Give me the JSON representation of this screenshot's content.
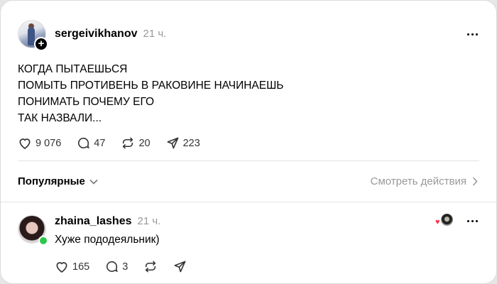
{
  "post": {
    "username": "sergeivikhanov",
    "time": "21 ч.",
    "text_lines": [
      "КОГДА ПЫТАЕШЬСЯ",
      "ПОМЫТЬ ПРОТИВЕНЬ В РАКОВИНЕ НАЧИНАЕШЬ",
      "ПОНИМАТЬ ПОЧЕМУ ЕГО",
      "ТАК НАЗВАЛИ..."
    ],
    "likes": "9 076",
    "replies": "47",
    "reposts": "20",
    "shares": "223",
    "follow_glyph": "+"
  },
  "sort": {
    "label": "Популярные",
    "view_activity": "Смотреть действия"
  },
  "reply": {
    "username": "zhaina_lashes",
    "time": "21 ч.",
    "text": "Хуже пододеяльник)",
    "likes": "165",
    "replies": "3"
  },
  "colors": {
    "heart": "#ff3040",
    "online": "#2cc84a",
    "muted": "#999999"
  },
  "icons": [
    "heart-icon",
    "comment-icon",
    "repost-icon",
    "share-icon",
    "more-icon",
    "chevron-down-icon",
    "chevron-right-icon"
  ]
}
